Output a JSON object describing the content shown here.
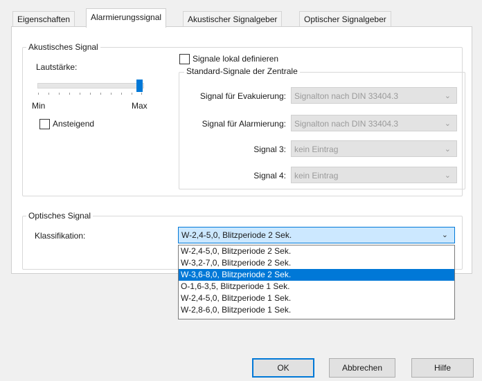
{
  "tabs": [
    {
      "label": "Eigenschaften"
    },
    {
      "label": "Alarmierungssignal"
    },
    {
      "label": "Akustischer Signalgeber"
    },
    {
      "label": "Optischer Signalgeber"
    }
  ],
  "acoustic": {
    "group_label": "Akustisches Signal",
    "volume_label": "Lautstärke:",
    "volume_level": 1.0,
    "min_label": "Min",
    "max_label": "Max",
    "rising_label": "Ansteigend",
    "rising_checked": false,
    "local_label": "Signale lokal definieren",
    "local_checked": false,
    "standard_group_label": "Standard-Signale der Zentrale",
    "signals": [
      {
        "label": "Signal für Evakuierung:",
        "value": "Signalton nach DIN 33404.3"
      },
      {
        "label": "Signal für Alarmierung:",
        "value": "Signalton nach DIN 33404.3"
      },
      {
        "label": "Signal 3:",
        "value": "kein Eintrag"
      },
      {
        "label": "Signal 4:",
        "value": "kein Eintrag"
      }
    ]
  },
  "optical": {
    "group_label": "Optisches Signal",
    "class_label": "Klassifikation:",
    "selected_value": "W-2,4-5,0, Blitzperiode 2 Sek.",
    "options": [
      "W-2,4-5,0, Blitzperiode 2 Sek.",
      "W-3,2-7,0, Blitzperiode 2 Sek.",
      "W-3,6-8,0, Blitzperiode 2 Sek.",
      "O-1,6-3,5, Blitzperiode 1 Sek.",
      "W-2,4-5,0, Blitzperiode 1 Sek.",
      "W-2,8-6,0, Blitzperiode 1 Sek."
    ],
    "highlighted_index": 2
  },
  "buttons": {
    "ok": "OK",
    "cancel": "Abbrechen",
    "help": "Hilfe"
  },
  "colors": {
    "highlight": "#0078d7",
    "combo_focus_bg": "#cce8ff",
    "slider_thumb": "#0078d7"
  }
}
